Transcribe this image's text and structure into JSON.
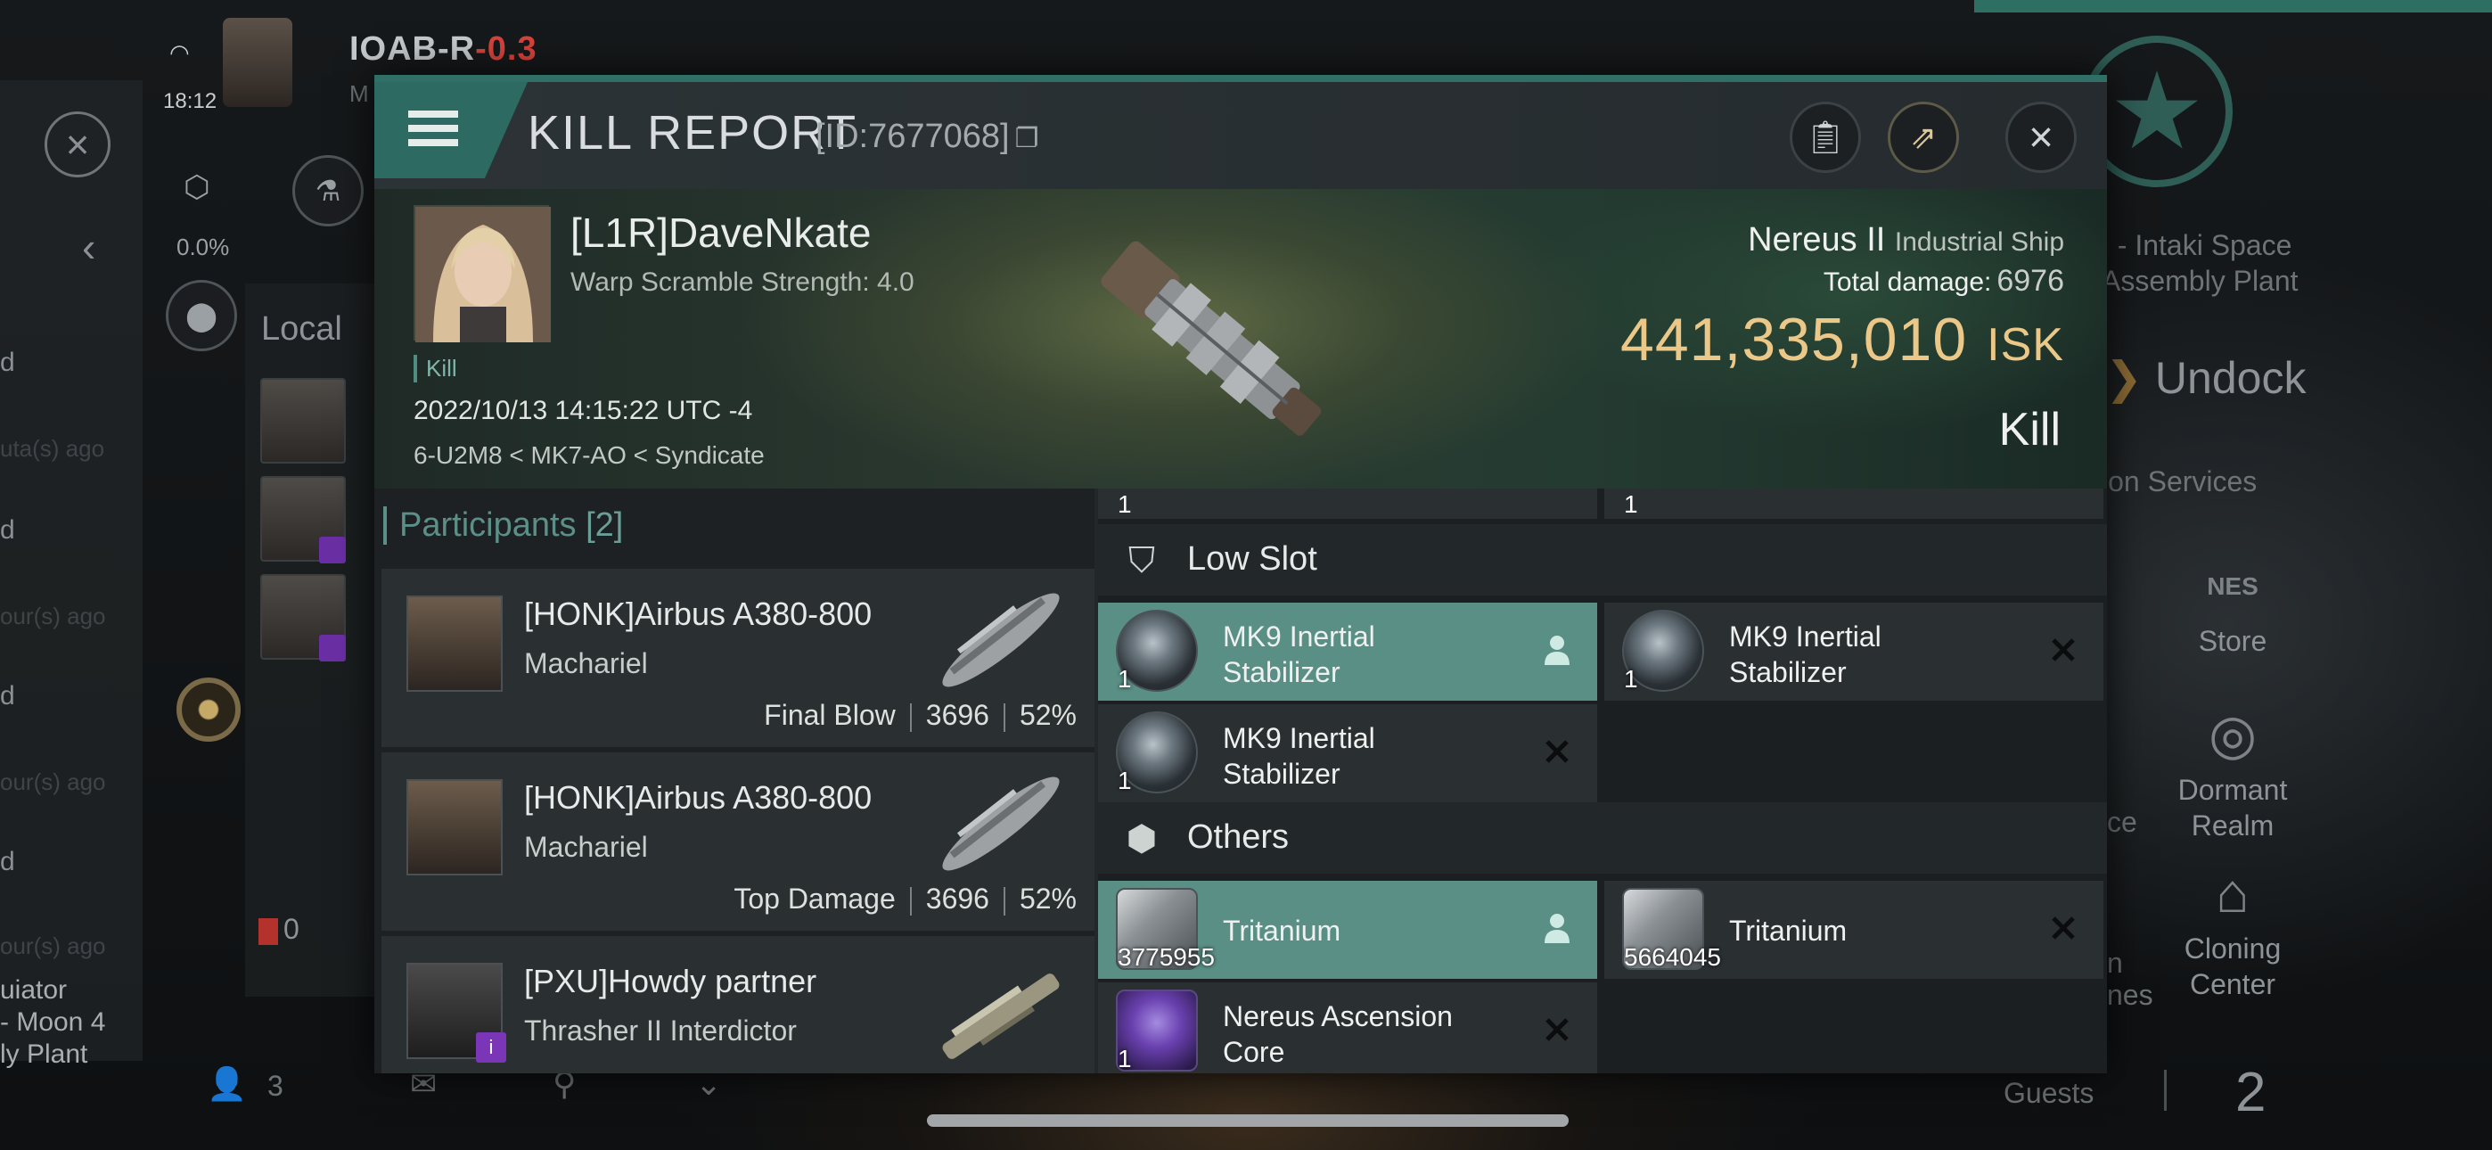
{
  "background": {
    "status_time": "18:12",
    "system_name": "IOAB-R",
    "system_sec": "-0.3",
    "system_sub": "M",
    "left_percent": "0.0%",
    "local_label": "Local",
    "alert_count": "0",
    "online_count": "3",
    "left_snippets": [
      "d",
      "d",
      "d",
      "d"
    ],
    "left_bottom": [
      "uiator",
      "- Moon 4",
      "ly Plant"
    ],
    "station_name": [
      "I - Intaki Space",
      "Assembly Plant"
    ],
    "undock_label": "Undock",
    "station_services": "ion Services",
    "store_label": "Store",
    "dormant_label": "Dormant Realm",
    "cloning_label": "Cloning Center",
    "partial_ce": "ce",
    "partial_n": "n",
    "partial_nes": "nes",
    "guests_label": "Guests",
    "guests_count": "2",
    "store_emblem": "NES"
  },
  "dialog": {
    "title": "KILL REPORT",
    "id_text": "[ID:7677068]",
    "menu_icon": "hamburger-icon",
    "buttons": [
      "clipboard-icon",
      "share-icon",
      "close-icon"
    ]
  },
  "victim": {
    "name": "[L1R]DaveNkate",
    "warp_scramble": "Warp Scramble Strength: 4.0",
    "tag": "Kill",
    "timestamp": "2022/10/13 14:15:22 UTC -4",
    "location": "6-U2M8 < MK7-AO < Syndicate",
    "ship_name": "Nereus II",
    "ship_class": "Industrial Ship",
    "total_damage_label": "Total damage:",
    "total_damage": "6976",
    "isk_value": "441,335,010",
    "isk_unit": "ISK",
    "result": "Kill"
  },
  "participants": {
    "label": "Participants",
    "count": "[2]",
    "rows": [
      {
        "name": "[HONK]Airbus A380-800",
        "ship": "Machariel",
        "role": "Final Blow",
        "damage": "3696",
        "percent": "52%"
      },
      {
        "name": "[HONK]Airbus A380-800",
        "ship": "Machariel",
        "role": "Top Damage",
        "damage": "3696",
        "percent": "52%"
      },
      {
        "name": "[PXU]Howdy partner",
        "ship": "Thrasher II Interdictor",
        "role": "",
        "damage": "",
        "percent": ""
      }
    ]
  },
  "fitting": {
    "cut_qty_left": "1",
    "cut_qty_right": "1",
    "low_slot_label": "Low Slot",
    "others_label": "Others",
    "low_slot_items": [
      {
        "name_line1": "MK9 Inertial",
        "name_line2": "Stabilizer",
        "qty": "1",
        "status": "dropped"
      },
      {
        "name_line1": "MK9 Inertial",
        "name_line2": "Stabilizer",
        "qty": "1",
        "status": "destroyed"
      },
      {
        "name_line1": "MK9 Inertial",
        "name_line2": "Stabilizer",
        "qty": "1",
        "status": "destroyed"
      }
    ],
    "other_items": [
      {
        "name": "Tritanium",
        "qty": "3775955",
        "status": "dropped"
      },
      {
        "name": "Tritanium",
        "qty": "5664045",
        "status": "destroyed"
      },
      {
        "name_line1": "Nereus Ascension",
        "name_line2": "Core",
        "qty": "1",
        "status": "destroyed"
      }
    ]
  },
  "colors": {
    "accent_teal": "#2f6f66",
    "dropped_row": "#5a8f86",
    "isk_gold": "#ecc888",
    "security_red": "#d6433b"
  }
}
